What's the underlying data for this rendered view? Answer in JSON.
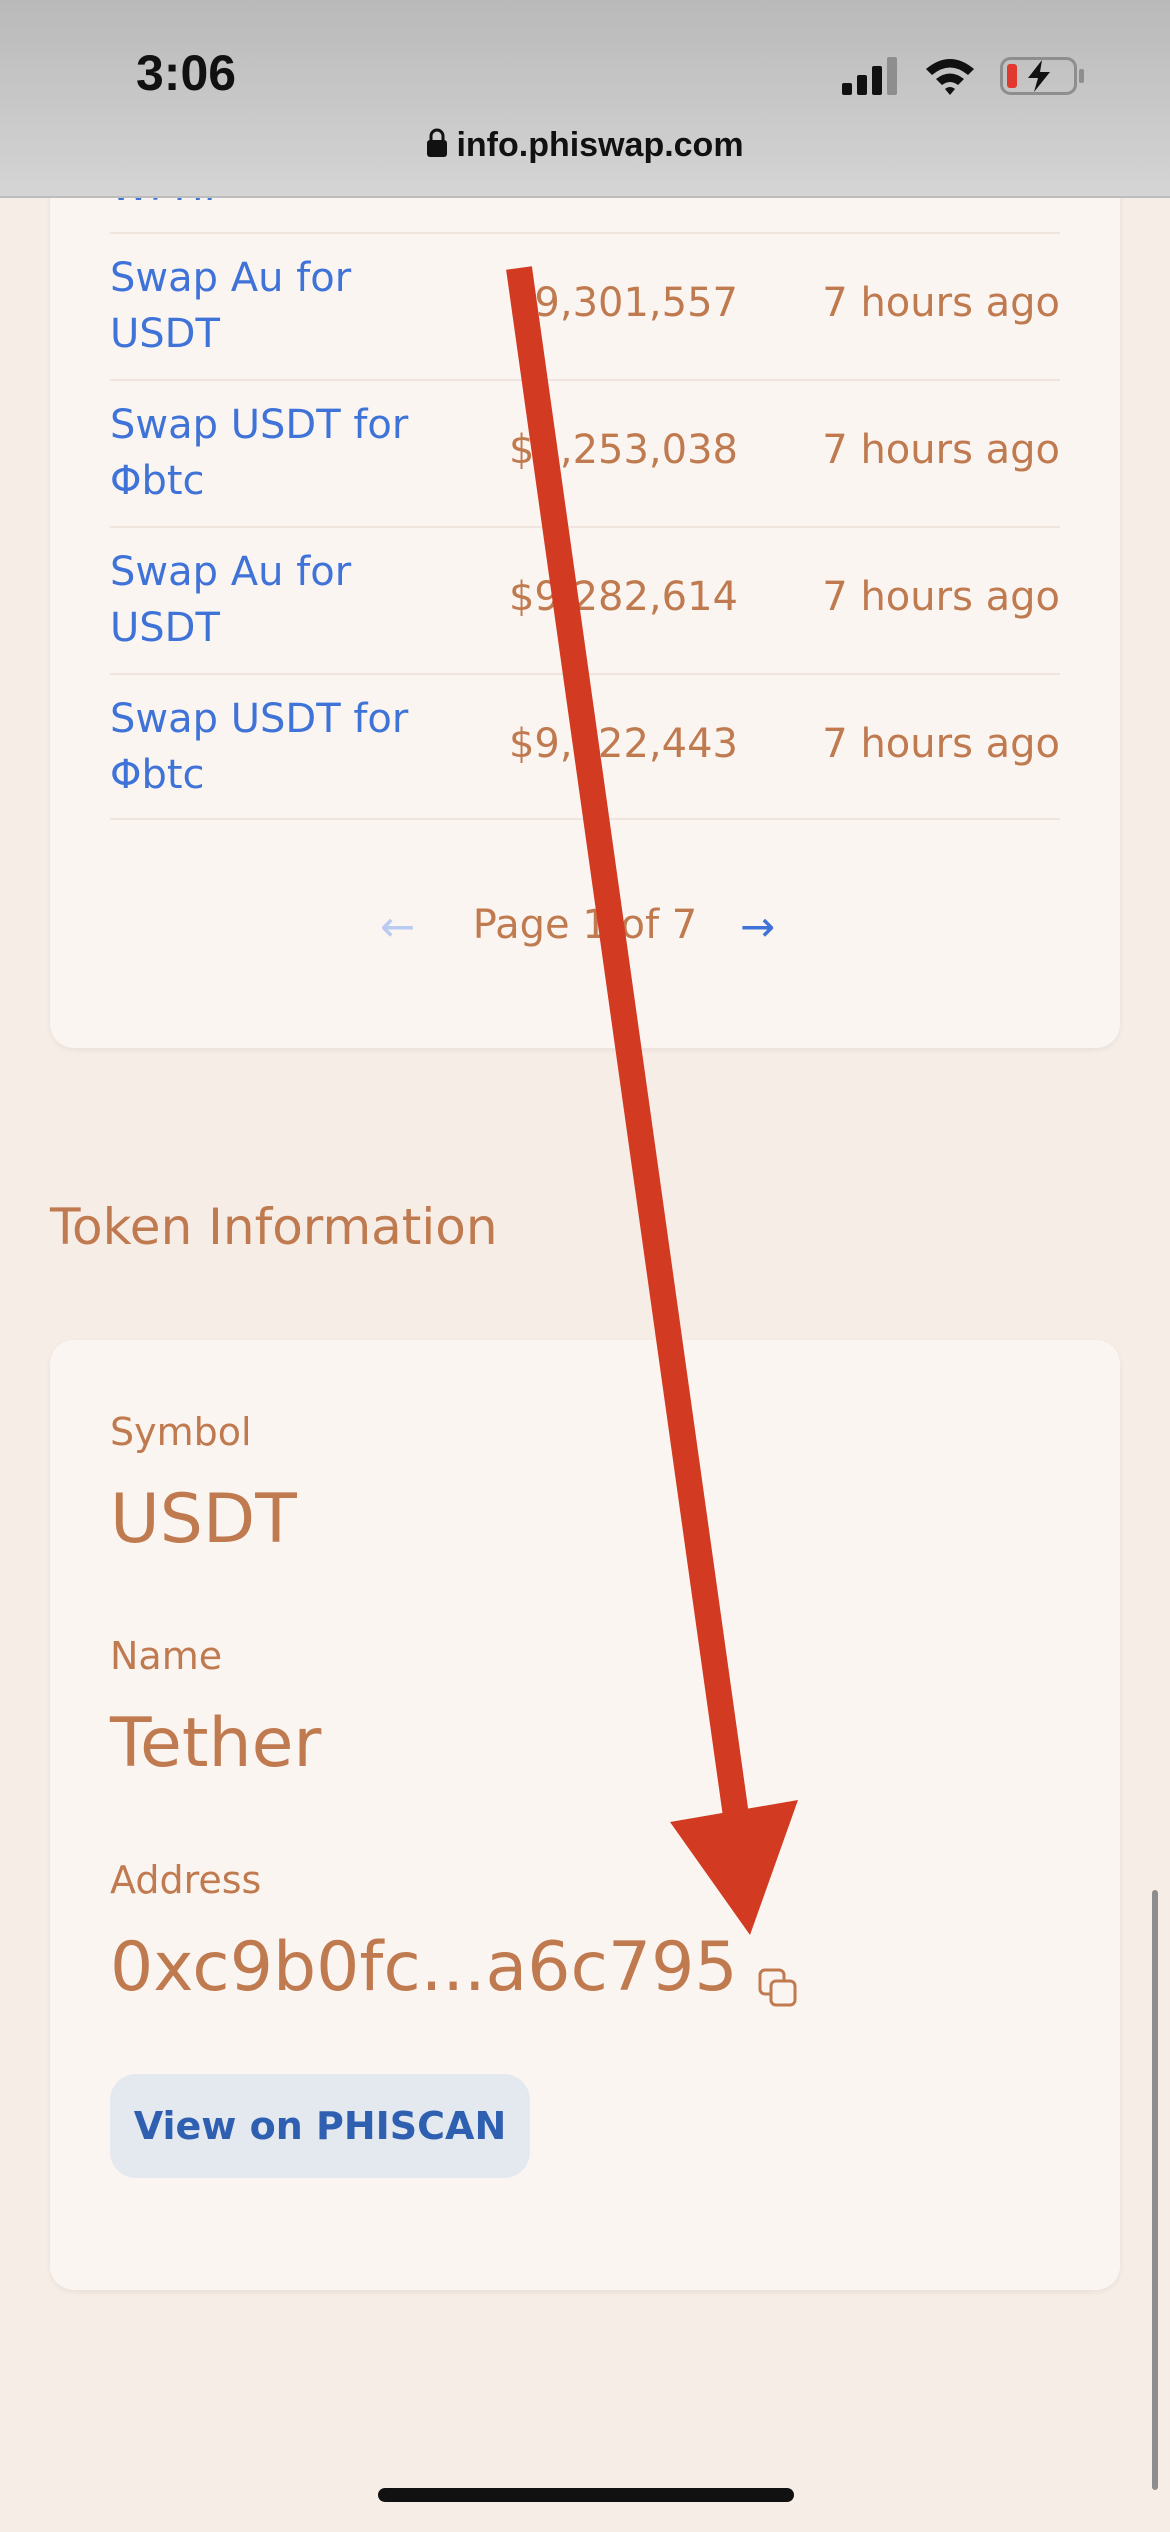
{
  "status_bar": {
    "time": "3:06"
  },
  "browser": {
    "url": "info.phiswap.com"
  },
  "transactions": {
    "partial_row_label": "WPHI",
    "rows": [
      {
        "action": "Swap Au for USDT",
        "value": "$9,301,557",
        "time": "7 hours ago"
      },
      {
        "action": "Swap USDT for Φbtc",
        "value": "$9,253,038",
        "time": "7 hours ago"
      },
      {
        "action": "Swap Au for USDT",
        "value": "$9,282,614",
        "time": "7 hours ago"
      },
      {
        "action": "Swap USDT for Φbtc",
        "value": "$9,222,443",
        "time": "7 hours ago"
      }
    ],
    "pagination": {
      "prev": "←",
      "label": "Page 1 of 7",
      "next": "→"
    }
  },
  "token_info": {
    "title": "Token Information",
    "symbol_label": "Symbol",
    "symbol": "USDT",
    "name_label": "Name",
    "name": "Tether",
    "address_label": "Address",
    "address": "0xc9b0fc...a6c795",
    "view_button": "View on PHISCAN"
  },
  "colors": {
    "page_bg": "#f7ede7",
    "card_bg": "#fbf5f2",
    "link_blue": "#3f73d8",
    "accent_brown": "#c07a4f",
    "annotation_arrow": "#d33a22"
  },
  "icons": [
    "lock-icon",
    "signal-icon",
    "wifi-icon",
    "battery-charging-icon",
    "copy-icon",
    "annotation-arrow"
  ]
}
